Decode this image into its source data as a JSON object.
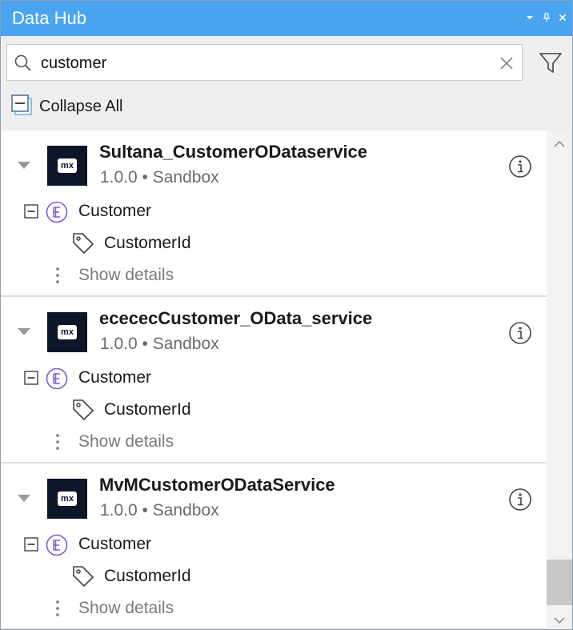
{
  "window": {
    "title": "Data Hub",
    "controls": [
      "dropdown-icon",
      "pin-icon",
      "close-icon"
    ]
  },
  "search": {
    "value": "customer",
    "placeholder": ""
  },
  "toolbar": {
    "collapse_all_label": "Collapse All"
  },
  "results": [
    {
      "name": "Sultana_CustomerODataservice",
      "meta": "1.0.0 • Sandbox",
      "logo_text": "mx",
      "entity": "Customer",
      "attribute": "CustomerId",
      "details_label": "Show details"
    },
    {
      "name": "ecececCustomer_OData_service",
      "meta": "1.0.0 • Sandbox",
      "logo_text": "mx",
      "entity": "Customer",
      "attribute": "CustomerId",
      "details_label": "Show details"
    },
    {
      "name": "MvMCustomerODataService",
      "meta": "1.0.0 • Sandbox",
      "logo_text": "mx",
      "entity": "Customer",
      "attribute": "CustomerId",
      "details_label": "Show details"
    }
  ],
  "colors": {
    "titlebar": "#4aa5f0",
    "entity_icon": "#7b5cd6",
    "logo_bg": "#0b1628"
  }
}
